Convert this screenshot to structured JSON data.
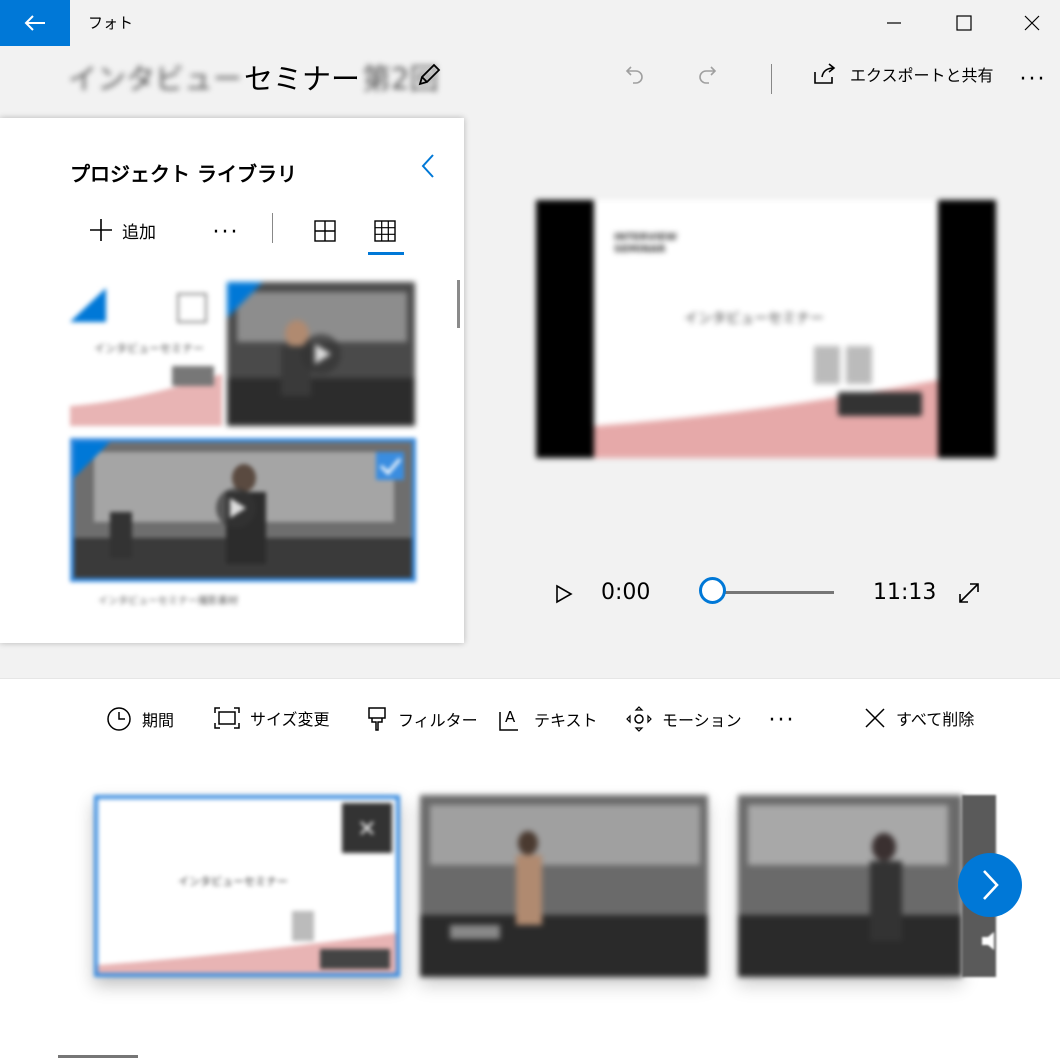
{
  "app": {
    "name": "フォト"
  },
  "header": {
    "title_prefix": "インタビュー",
    "title": "セミナー",
    "title_suffix": "第2回",
    "export_label": "エクスポートと共有"
  },
  "library": {
    "title": "プロジェクト ライブラリ",
    "add_label": "追加",
    "thumb1_caption": "インタビューセミナー",
    "thumb3_caption": "インタビューセミナー撮影素材"
  },
  "preview": {
    "slide_heading": "INTERVIEW SEMINAR",
    "slide_title": "インタビューセミナー"
  },
  "playback": {
    "current_time": "0:00",
    "total_time": "11:13",
    "progress": 0
  },
  "storyboard": {
    "tools": [
      "期間",
      "サイズ変更",
      "フィルター",
      "テキスト",
      "モーション"
    ],
    "delete_all_label": "すべて削除",
    "clip1_title": "インタビューセミナー"
  },
  "colors": {
    "accent": "#0078d7",
    "pink": "#e8b4b4"
  }
}
